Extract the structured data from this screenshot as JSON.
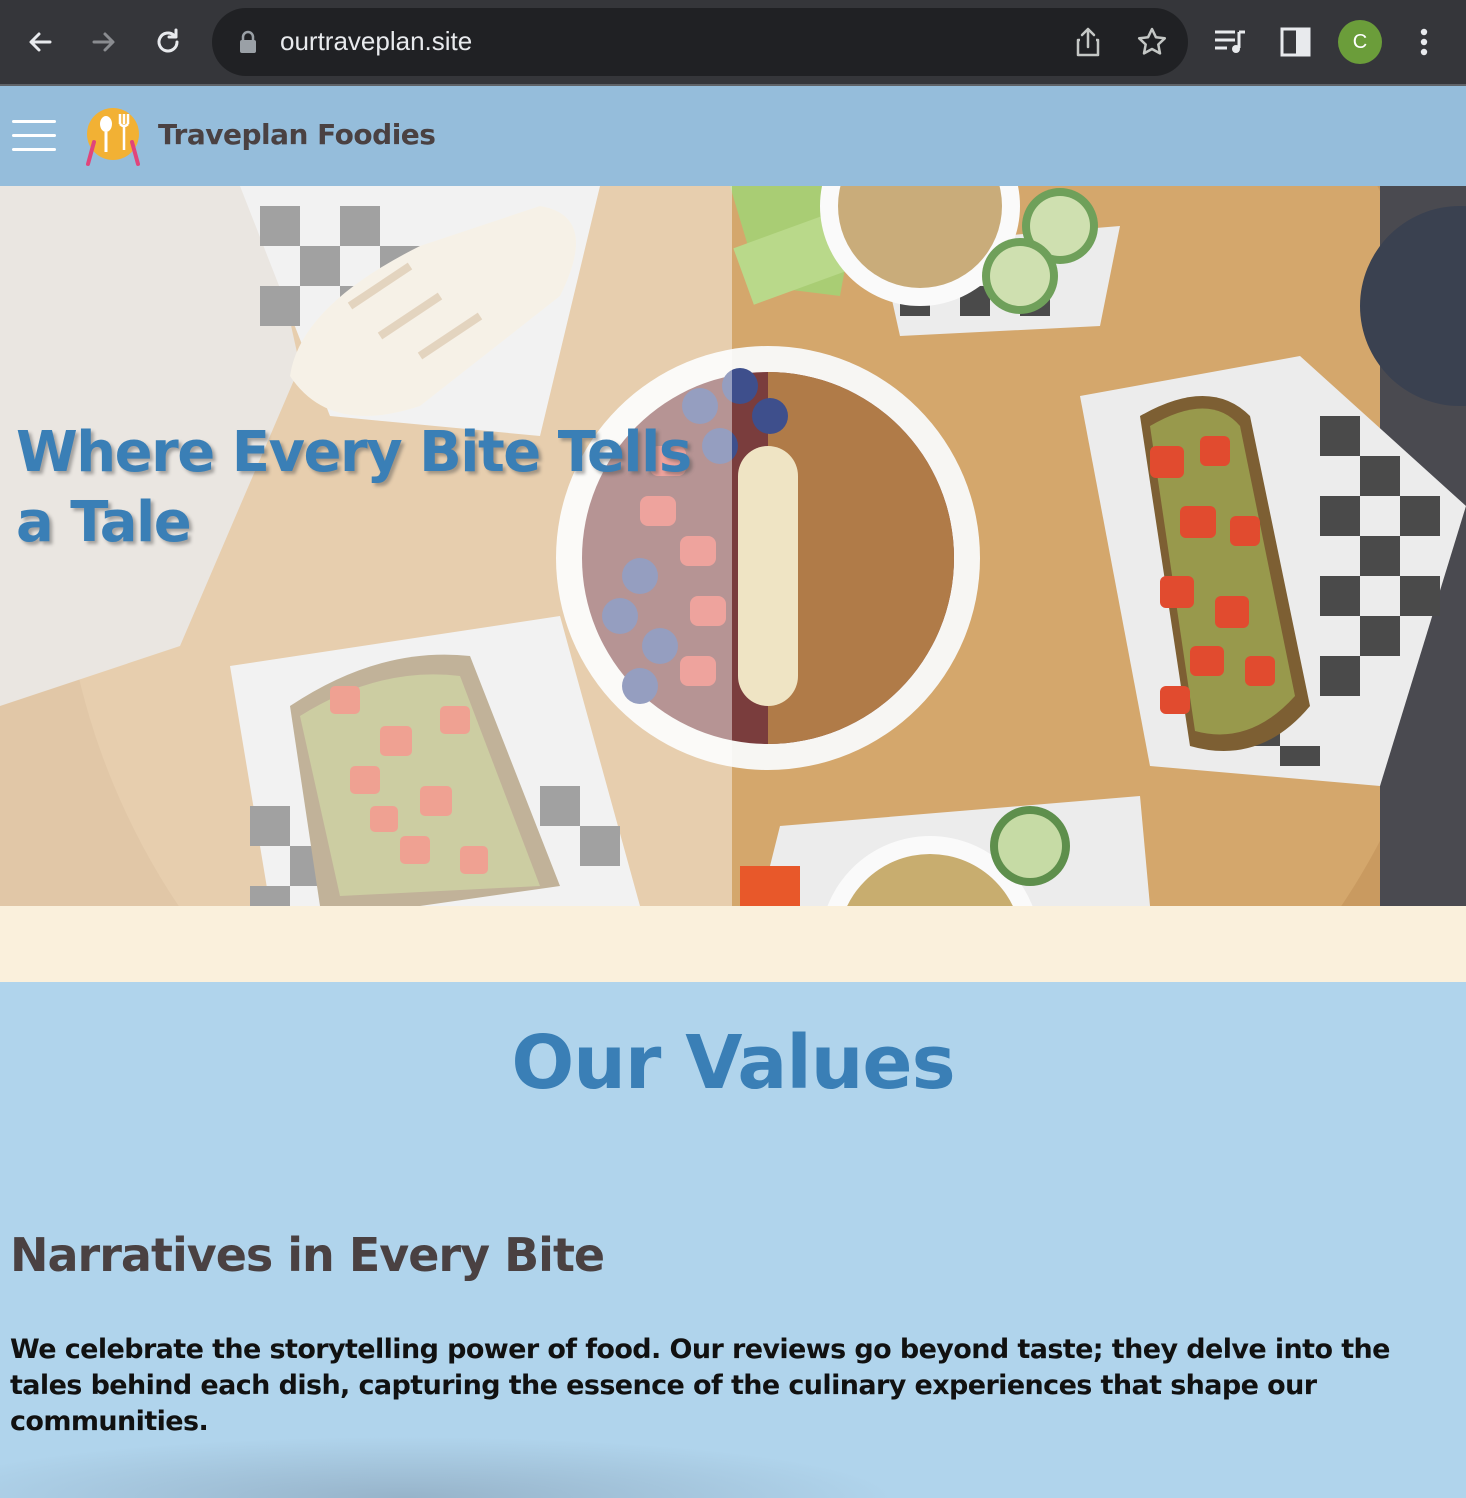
{
  "browser": {
    "url": "ourtraveplan.site",
    "profile_initial": "C",
    "icons": [
      "back-arrow-icon",
      "forward-arrow-icon",
      "reload-icon",
      "lock-icon",
      "share-icon",
      "star-icon",
      "media-queue-icon",
      "side-panel-icon",
      "kebab-menu-icon"
    ]
  },
  "site": {
    "brand": "Traveplan Foodies",
    "hero_title": "Where Every Bite Tells a Tale"
  },
  "values": {
    "title": "Our Values",
    "heading": "Narratives in Every Bite",
    "text": "We celebrate the storytelling power of food. Our reviews go beyond taste; they delve into the tales behind each dish, capturing the essence of the culinary experiences that shape our communities."
  },
  "colors": {
    "header_bg": "#95bddb",
    "section_bg": "#b0d4ec",
    "accent_blue": "#3a7fb6",
    "dark_text": "#4a4142",
    "cream": "#faf0dc",
    "profile_green": "#6b9d3a"
  }
}
